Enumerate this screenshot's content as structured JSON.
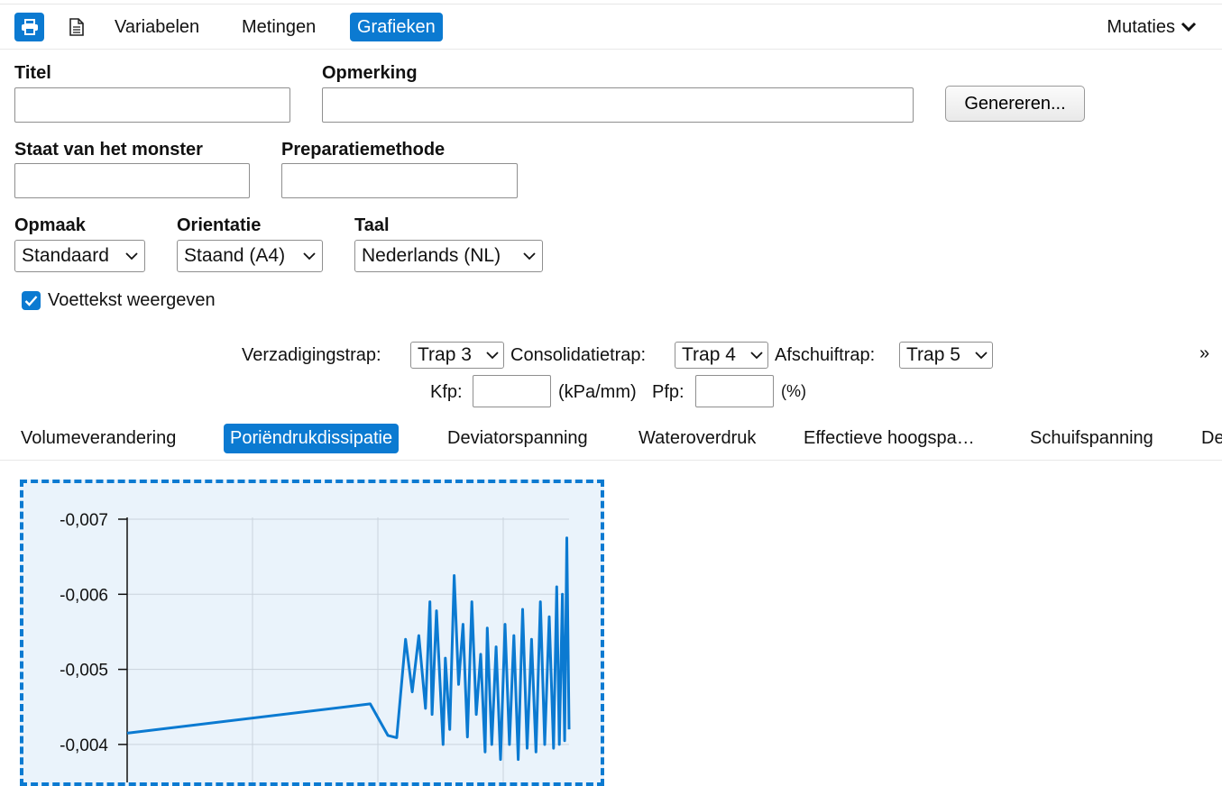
{
  "nav": {
    "print_icon": "printer-icon",
    "document_icon": "document-icon",
    "links": [
      "Variabelen",
      "Metingen",
      "Grafieken"
    ],
    "active": "Grafieken",
    "mutaties": "Mutaties"
  },
  "form": {
    "titel_label": "Titel",
    "titel_value": "",
    "opmerking_label": "Opmerking",
    "opmerking_value": "",
    "genereren_label": "Genereren...",
    "staat_label": "Staat van het monster",
    "staat_value": "",
    "preparatie_label": "Preparatiemethode",
    "preparatie_value": "",
    "opmaak_label": "Opmaak",
    "opmaak_value": "Standaard",
    "orientatie_label": "Orientatie",
    "orientatie_value": "Staand (A4)",
    "taal_label": "Taal",
    "taal_value": "Nederlands (NL)",
    "voettekst_label": "Voettekst weergeven",
    "voettekst_checked": true
  },
  "stages": {
    "verzadiging_label": "Verzadigingstrap:",
    "verzadiging_value": "Trap 3",
    "consolidatie_label": "Consolidatietrap:",
    "consolidatie_value": "Trap 4",
    "afschuif_label": "Afschuiftrap:",
    "afschuif_value": "Trap 5",
    "more": "»",
    "kfp_label": "Kfp:",
    "kfp_value": "",
    "kfp_unit": "(kPa/mm)",
    "pfp_label": "Pfp:",
    "pfp_value": "",
    "pfp_unit": "(%)"
  },
  "tabs": [
    "Volumeverandering",
    "Poriëndrukdissipatie",
    "Deviatorspanning",
    "Wateroverdruk",
    "Effectieve hoogspa…",
    "Schuifspanning",
    "De"
  ],
  "active_tab": "Poriëndrukdissipatie",
  "colors": {
    "accent": "#0b7ad1",
    "chart_bg": "#eaf3fb"
  },
  "chart_data": {
    "type": "line",
    "y_ticks": [
      "-0,007",
      "-0,006",
      "-0,005",
      "-0,004"
    ],
    "ylim": [
      -0.0072,
      -0.0038
    ],
    "grid": true,
    "series": [
      {
        "values_note_excluded": false,
        "points": [
          [
            0,
            -0.00415
          ],
          [
            0.55,
            -0.00454
          ],
          [
            0.59,
            -0.00412
          ],
          [
            0.61,
            -0.00409
          ],
          [
            0.63,
            -0.0054
          ],
          [
            0.645,
            -0.0047
          ],
          [
            0.66,
            -0.00545
          ],
          [
            0.675,
            -0.00448
          ],
          [
            0.685,
            -0.0059
          ],
          [
            0.69,
            -0.0044
          ],
          [
            0.7,
            -0.00578
          ],
          [
            0.715,
            -0.004
          ],
          [
            0.72,
            -0.00515
          ],
          [
            0.73,
            -0.0042
          ],
          [
            0.74,
            -0.00625
          ],
          [
            0.75,
            -0.0048
          ],
          [
            0.76,
            -0.0056
          ],
          [
            0.77,
            -0.0041
          ],
          [
            0.78,
            -0.0059
          ],
          [
            0.79,
            -0.0044
          ],
          [
            0.8,
            -0.0052
          ],
          [
            0.81,
            -0.0039
          ],
          [
            0.815,
            -0.00555
          ],
          [
            0.825,
            -0.004
          ],
          [
            0.835,
            -0.0053
          ],
          [
            0.845,
            -0.0038
          ],
          [
            0.855,
            -0.0056
          ],
          [
            0.865,
            -0.004
          ],
          [
            0.875,
            -0.00545
          ],
          [
            0.885,
            -0.0038
          ],
          [
            0.895,
            -0.0058
          ],
          [
            0.905,
            -0.00395
          ],
          [
            0.915,
            -0.0054
          ],
          [
            0.925,
            -0.0039
          ],
          [
            0.935,
            -0.0059
          ],
          [
            0.945,
            -0.004
          ],
          [
            0.955,
            -0.0057
          ],
          [
            0.965,
            -0.00395
          ],
          [
            0.972,
            -0.0061
          ],
          [
            0.978,
            -0.004
          ],
          [
            0.985,
            -0.006
          ],
          [
            0.99,
            -0.00405
          ],
          [
            0.995,
            -0.00675
          ],
          [
            1.0,
            -0.0042
          ]
        ]
      }
    ]
  }
}
